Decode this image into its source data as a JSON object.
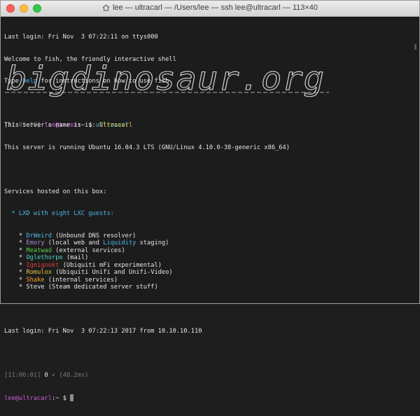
{
  "window": {
    "title": "lee — ultracarl — /Users/lee — ssh lee@ultracarl — 113×40"
  },
  "login": {
    "line1": "Last login: Fri Nov  3 07:22:11 on ttys000",
    "welcome": "Welcome to fish, the friendly interactive shell",
    "help_prefix": "Type ",
    "help_word": "help",
    "help_suffix": " for instructions on how to use fish"
  },
  "local_prompt": {
    "time": "[11:05:58]",
    "user_host": "lee@t-rex",
    "sep": ":~ $",
    "command": "ultracarl",
    "right_mark": "["
  },
  "banner": {
    "text": "bigdinosaur.org"
  },
  "server": {
    "name_prefix": "This server's name is is: ",
    "name": "Ultracarl",
    "os": "This server is running Ubuntu 16.04.3 LTS (GNU/Linux 4.10.0-38-generic x86_64)",
    "services_header": "Services hosted on this box:",
    "lxd_line": "* LXD with eight LXC guests:",
    "guests": [
      {
        "bullet": "*",
        "name": "DrWeird",
        "name_color": "#4fb7e8",
        "desc": "(Unbound DNS resolver)",
        "extra": "",
        "extra_color": "",
        "after": ""
      },
      {
        "bullet": "*",
        "name": "Emory",
        "name_color": "#b48ad6",
        "desc": "(local web and ",
        "extra": "Liquidity",
        "extra_color": "#4fb7e8",
        "after": " staging)"
      },
      {
        "bullet": "*",
        "name": "Meatwad",
        "name_color": "#5ad047",
        "desc": "(external services)",
        "extra": "",
        "extra_color": "",
        "after": ""
      },
      {
        "bullet": "*",
        "name": "Oglethorpe",
        "name_color": "#4fd0c0",
        "desc": "(mail)",
        "extra": "",
        "extra_color": "",
        "after": ""
      },
      {
        "bullet": "*",
        "name": "Ignignokt",
        "name_color": "#e23b3b",
        "desc": "(Ubiquiti mFi experimental)",
        "extra": "",
        "extra_color": "",
        "after": ""
      },
      {
        "bullet": "*",
        "name": "Romulox",
        "name_color": "#e8c341",
        "desc": "(Ubiquiti Unifi and Unifi-Video)",
        "extra": "",
        "extra_color": "",
        "after": ""
      },
      {
        "bullet": "*",
        "name": "Shake",
        "name_color": "#f0a030",
        "desc": "(internal services)",
        "extra": "",
        "extra_color": "",
        "after": ""
      },
      {
        "bullet": "*",
        "name": "Steve",
        "name_color": "#e6e6e6",
        "desc": "(Steam dedicated server stuff)",
        "extra": "",
        "extra_color": "",
        "after": ""
      }
    ],
    "last_login": "Last login: Fri Nov  3 07:22:13 2017 from 10.10.10.110"
  },
  "remote_prompt": {
    "status_time": "[11:06:01]",
    "status_code": "0",
    "status_check": "✓",
    "status_duration": "(48.2ms)",
    "user_host": "lee@ultracarl",
    "sep": ":~ $"
  },
  "colors": {
    "background": "#1c1c1c",
    "foreground": "#e6e6e6",
    "green": "#5ad047",
    "magenta": "#cf5bd6",
    "cyan": "#4fb7e8"
  }
}
